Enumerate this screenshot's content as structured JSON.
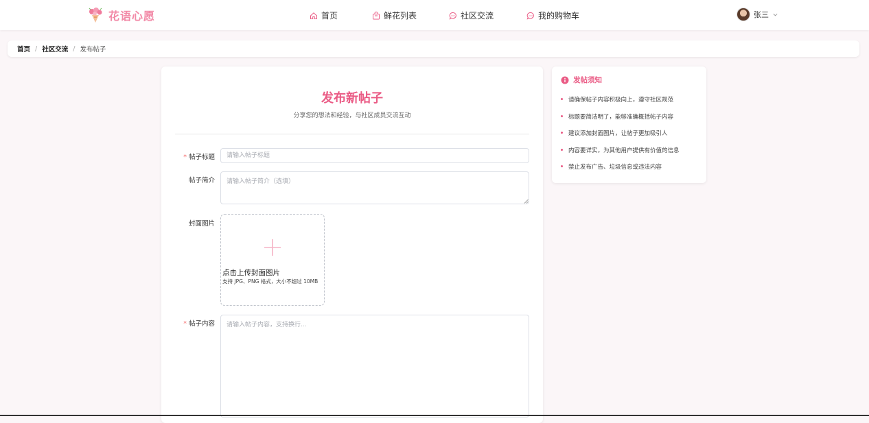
{
  "brand": {
    "name": "花语心愿"
  },
  "nav": {
    "items": [
      {
        "label": "首页",
        "icon": "home-icon"
      },
      {
        "label": "鲜花列表",
        "icon": "bag-icon"
      },
      {
        "label": "社区交流",
        "icon": "chat-icon"
      },
      {
        "label": "我的购物车",
        "icon": "chat-icon"
      }
    ]
  },
  "user": {
    "name": "张三"
  },
  "breadcrumb": {
    "items": [
      "首页",
      "社区交流"
    ],
    "current": "发布帖子",
    "separator": "/"
  },
  "form": {
    "title": "发布新帖子",
    "subtitle": "分享您的想法和经验，与社区成员交流互动",
    "fields": {
      "title": {
        "label": "帖子标题",
        "required_mark": "*",
        "placeholder": "请输入帖子标题",
        "value": ""
      },
      "summary": {
        "label": "帖子简介",
        "placeholder": "请输入帖子简介（选填）",
        "value": ""
      },
      "cover": {
        "label": "封面图片",
        "upload_text": "点击上传封面图片",
        "hint": "支持 JPG、PNG 格式，大小不超过 10MB"
      },
      "content": {
        "label": "帖子内容",
        "required_mark": "*",
        "placeholder": "请输入帖子内容，支持换行...",
        "value": ""
      }
    }
  },
  "notice": {
    "title": "发帖须知",
    "tips": [
      "请确保帖子内容积极向上，遵守社区规范",
      "标题要简洁明了，能够准确概括帖子内容",
      "建议添加封面图片，让帖子更加吸引人",
      "内容要详实，为其他用户提供有价值的信息",
      "禁止发布广告、垃圾信息或违法内容"
    ]
  },
  "colors": {
    "accent": "#ea5b85",
    "brand": "#f28aa7",
    "required": "#f56c6c",
    "background": "#fbf6f8"
  }
}
